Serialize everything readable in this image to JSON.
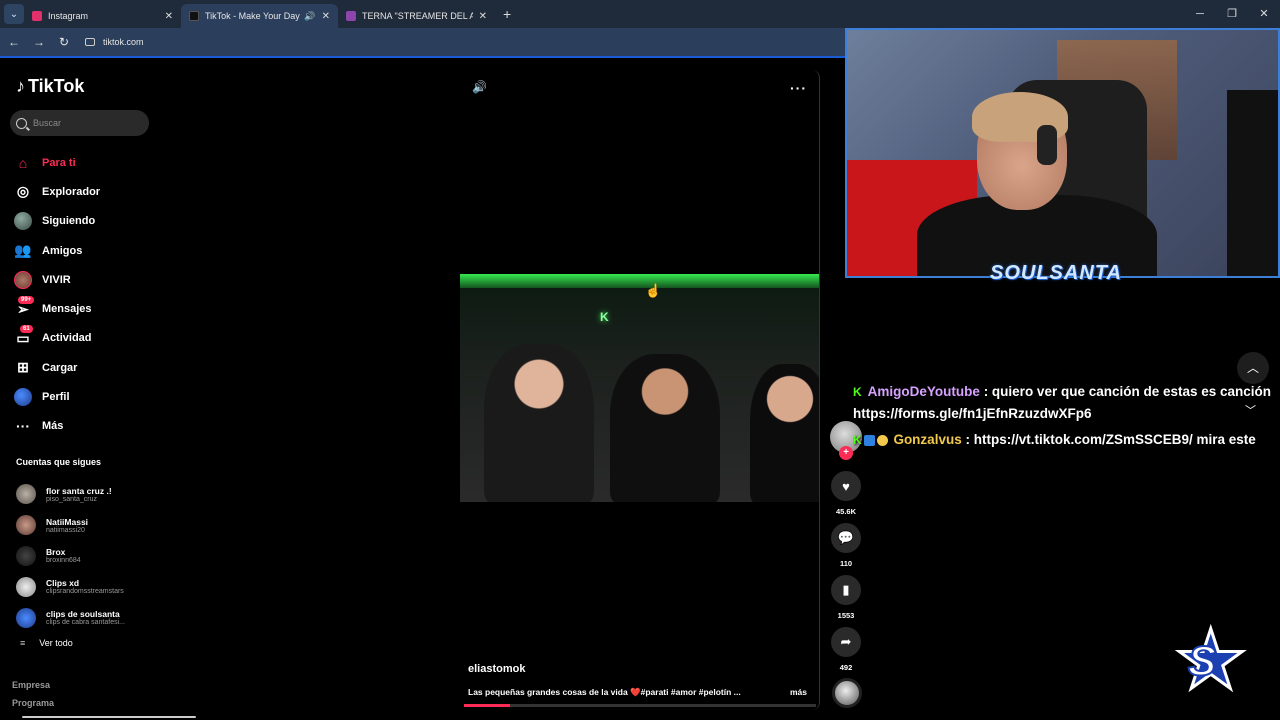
{
  "browser": {
    "tabs": [
      {
        "title": "Instagram",
        "active": false,
        "color": "#e1306c"
      },
      {
        "title": "TikTok - Make Your Day",
        "active": true,
        "color": "#111111"
      },
      {
        "title": "TERNA \"STREAMER DEL AÑO\"",
        "active": false,
        "color": "#8e44ad"
      }
    ],
    "url": "tiktok.com"
  },
  "sidebar": {
    "logo": "TikTok",
    "search_placeholder": "Buscar",
    "nav": [
      {
        "label": "Para ti",
        "icon": "home-icon",
        "active": true
      },
      {
        "label": "Explorador",
        "icon": "compass-icon",
        "active": false
      },
      {
        "label": "Siguiendo",
        "icon": "following-avatar-icon",
        "active": false
      },
      {
        "label": "Amigos",
        "icon": "friends-icon",
        "active": false
      },
      {
        "label": "VIVIR",
        "icon": "live-avatar-icon",
        "active": false
      },
      {
        "label": "Mensajes",
        "icon": "messages-icon",
        "badge": "99+",
        "active": false
      },
      {
        "label": "Actividad",
        "icon": "activity-icon",
        "badge": "61",
        "active": false
      },
      {
        "label": "Cargar",
        "icon": "upload-icon",
        "active": false
      },
      {
        "label": "Perfil",
        "icon": "profile-avatar-icon",
        "active": false
      },
      {
        "label": "Más",
        "icon": "more-icon",
        "active": false
      }
    ],
    "following_title": "Cuentas que sigues",
    "following": [
      {
        "name": "flor santa cruz .!",
        "handle": "piso_santa_cruz"
      },
      {
        "name": "NatiiMassi",
        "handle": "natiimassi20"
      },
      {
        "name": "Brox",
        "handle": "broxinn684"
      },
      {
        "name": "Clips xd",
        "handle": "clipsrandomsstreamstars"
      },
      {
        "name": "clips de soulsanta",
        "handle": "clips de cabra santafesi..."
      }
    ],
    "see_all": "Ver todo",
    "footer": [
      "Empresa",
      "Programa"
    ]
  },
  "video": {
    "neon_sign": "K",
    "creator": "eliastomok",
    "caption": "Las pequeñas grandes cosas de la vida ❤️#parati #amor #pelotín ...",
    "more_label": "más",
    "progress": 0.13,
    "likes": "45.6K",
    "comments": "110",
    "saves": "1553",
    "shares": "492"
  },
  "overlay": {
    "cam_label": "SOULSANTA",
    "chat": [
      {
        "user": "AmigoDeYoutube",
        "text": ": quiero ver que canción de estas es canción"
      },
      {
        "user": "",
        "text": "https://forms.gle/fn1jEfnRzuzdwXFp6"
      },
      {
        "user": "Gonzalvus",
        "text": ": https://vt.tiktok.com/ZSmSSCEB9/ mira este"
      }
    ],
    "brand_letters": "S"
  }
}
